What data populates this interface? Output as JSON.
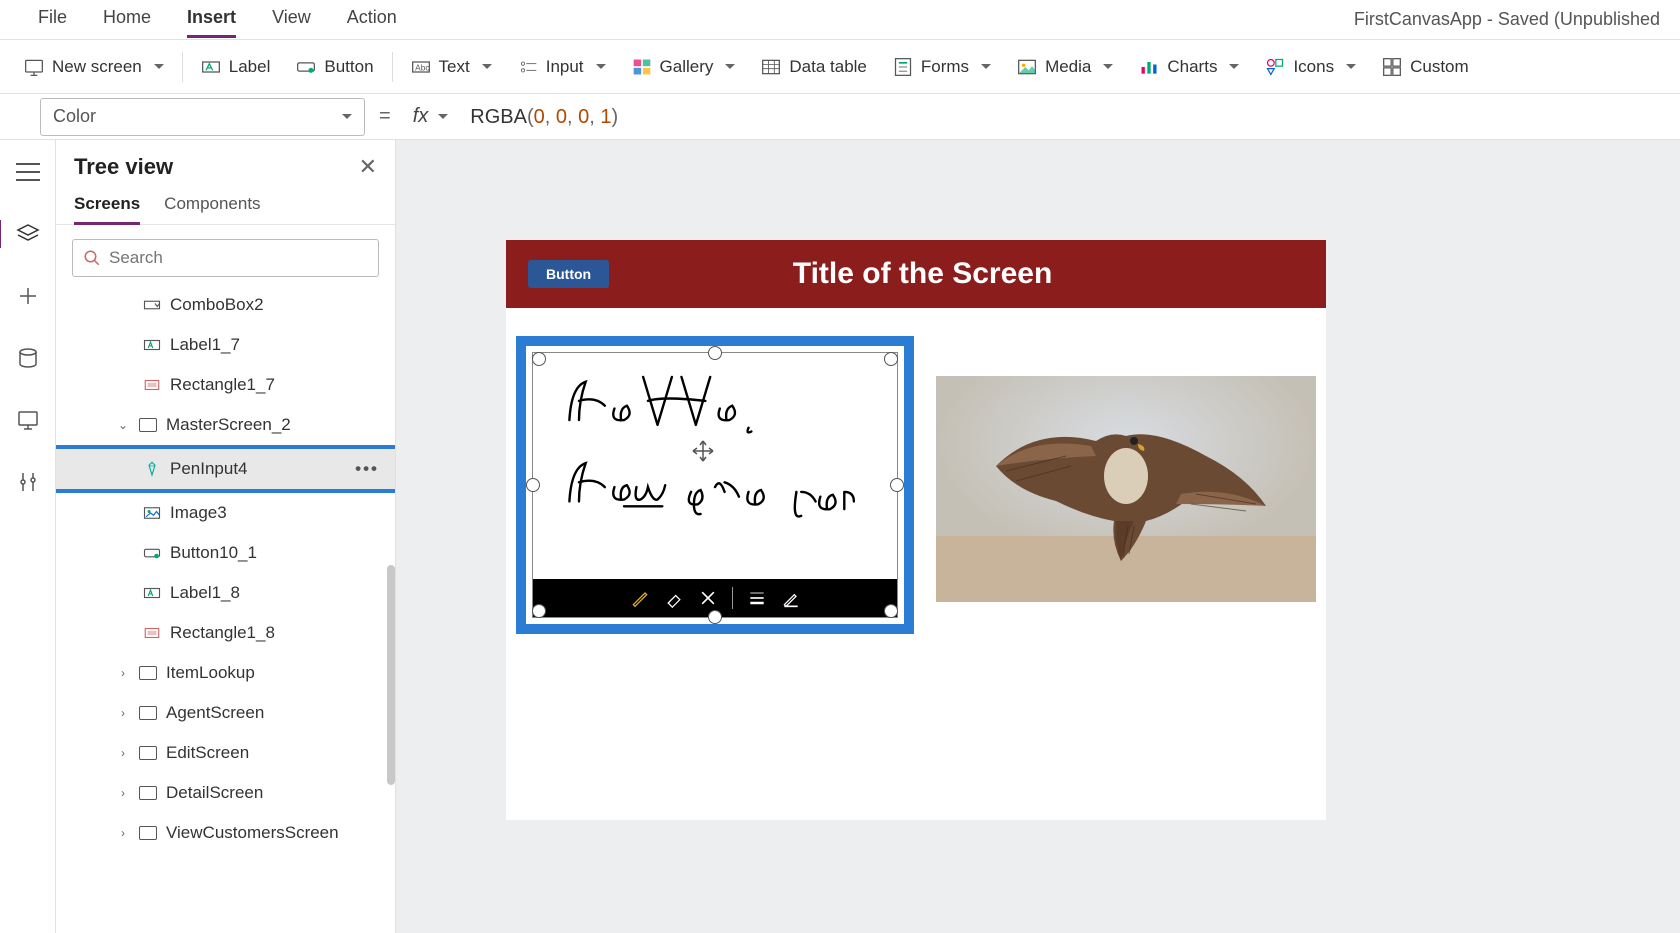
{
  "app_title": "FirstCanvasApp - Saved (Unpublished",
  "menu": {
    "file": "File",
    "home": "Home",
    "insert": "Insert",
    "view": "View",
    "action": "Action"
  },
  "ribbon": {
    "new_screen": "New screen",
    "label": "Label",
    "button": "Button",
    "text": "Text",
    "input": "Input",
    "gallery": "Gallery",
    "data_table": "Data table",
    "forms": "Forms",
    "media": "Media",
    "charts": "Charts",
    "icons": "Icons",
    "custom": "Custom"
  },
  "formula": {
    "property": "Color",
    "eq": "=",
    "fx": "fx",
    "fn": "RGBA",
    "open": "(",
    "close": ")",
    "args": [
      "0",
      "0",
      "0",
      "1"
    ],
    "comma": ", "
  },
  "treeview": {
    "title": "Tree view",
    "tabs": {
      "screens": "Screens",
      "components": "Components"
    },
    "search_placeholder": "Search",
    "nodes": [
      {
        "label": "ComboBox2",
        "icon": "combobox",
        "level": "lvl1"
      },
      {
        "label": "Label1_7",
        "icon": "label",
        "level": "lvl1"
      },
      {
        "label": "Rectangle1_7",
        "icon": "rectangle",
        "level": "lvl1"
      },
      {
        "label": "MasterScreen_2",
        "icon": "screen",
        "level": "lvl-screen",
        "expanded": true
      },
      {
        "label": "PenInput4",
        "icon": "pen",
        "level": "lvl-sel",
        "selected": true
      },
      {
        "label": "Image3",
        "icon": "image",
        "level": "lvl1"
      },
      {
        "label": "Button10_1",
        "icon": "button",
        "level": "lvl1"
      },
      {
        "label": "Label1_8",
        "icon": "label",
        "level": "lvl1"
      },
      {
        "label": "Rectangle1_8",
        "icon": "rectangle",
        "level": "lvl1"
      },
      {
        "label": "ItemLookup",
        "icon": "screen",
        "level": "lvl-screen",
        "collapsed": true
      },
      {
        "label": "AgentScreen",
        "icon": "screen",
        "level": "lvl-screen",
        "collapsed": true
      },
      {
        "label": "EditScreen",
        "icon": "screen",
        "level": "lvl-screen",
        "collapsed": true
      },
      {
        "label": "DetailScreen",
        "icon": "screen",
        "level": "lvl-screen",
        "collapsed": true
      },
      {
        "label": "ViewCustomersScreen",
        "icon": "screen",
        "level": "lvl-screen",
        "collapsed": true
      }
    ]
  },
  "canvas": {
    "header_button": "Button",
    "header_title": "Title of the Screen",
    "pen_text_line1": "Hello,",
    "pen_text_line2": "How are you"
  }
}
